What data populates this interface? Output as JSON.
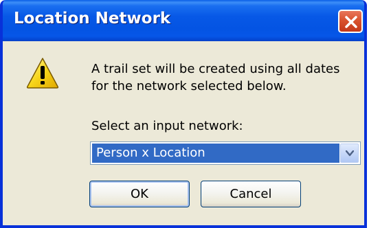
{
  "dialog": {
    "title": "Location Network",
    "message_lines": [
      "A trail set will be created using all dates",
      "for the network selected below."
    ],
    "select_label": "Select an input network:",
    "selected_network": "Person x Location",
    "ok_label": "OK",
    "cancel_label": "Cancel",
    "icons": {
      "dialog_icon": "warning-icon",
      "close": "close-icon",
      "dropdown": "chevron-down-icon"
    },
    "colors": {
      "titlebar": "#0454e3",
      "client_bg": "#ece9d8",
      "close_button": "#d9532e",
      "selection": "#316ac5",
      "warning_yellow": "#f7d51a"
    }
  }
}
